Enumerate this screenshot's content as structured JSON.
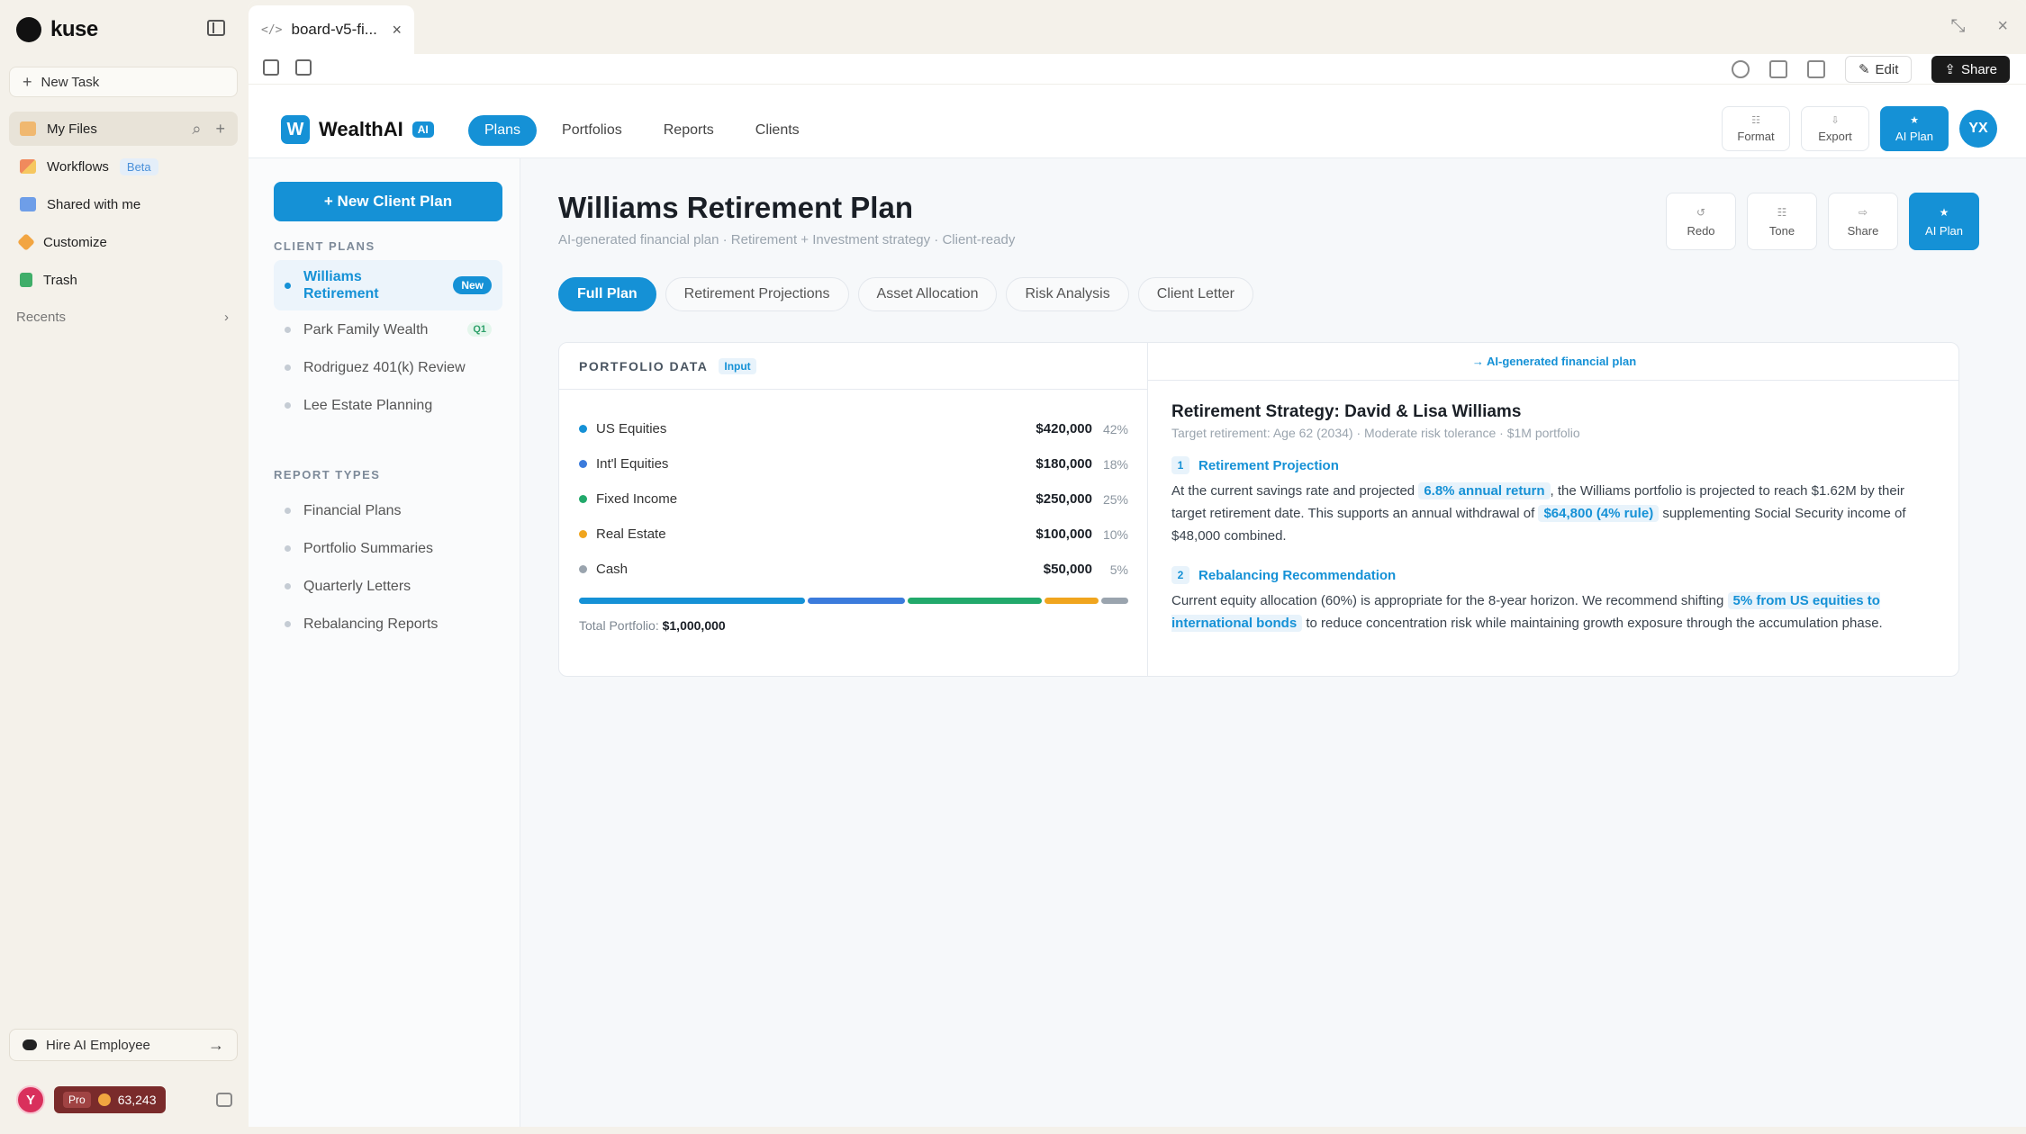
{
  "app": {
    "brand": "kuse",
    "new_task": "New Task",
    "nav": [
      {
        "label": "My Files",
        "icon": "folder-icon"
      },
      {
        "label": "Workflows",
        "icon": "workflow-icon",
        "badge": "Beta"
      },
      {
        "label": "Shared with me",
        "icon": "shared-icon"
      },
      {
        "label": "Customize",
        "icon": "customize-icon"
      },
      {
        "label": "Trash",
        "icon": "trash-icon"
      }
    ],
    "recents": "Recents",
    "hire": "Hire AI Employee",
    "user_initial": "Y",
    "plan_badge": "Pro",
    "credits": "63,243"
  },
  "window": {
    "tab_title": "board-v5-fi...",
    "edit_label": "Edit",
    "share_label": "Share"
  },
  "wealth": {
    "logo_letter": "W",
    "name": "WealthAI",
    "ai_badge": "AI",
    "nav": [
      "Plans",
      "Portfolios",
      "Reports",
      "Clients"
    ],
    "header_actions": [
      {
        "glyph": "☷",
        "label": "Format"
      },
      {
        "glyph": "⇩",
        "label": "Export"
      },
      {
        "glyph": "★",
        "label": "AI Plan"
      }
    ],
    "user_initials": "YX",
    "new_plan": "+ New Client Plan",
    "client_plans_label": "CLIENT PLANS",
    "client_plans": [
      {
        "label": "Williams Retirement",
        "badge": "New"
      },
      {
        "label": "Park Family Wealth",
        "badge": "Q1"
      },
      {
        "label": "Rodriguez 401(k) Review"
      },
      {
        "label": "Lee Estate Planning"
      }
    ],
    "report_types_label": "REPORT TYPES",
    "report_types": [
      "Financial Plans",
      "Portfolio Summaries",
      "Quarterly Letters",
      "Rebalancing Reports"
    ]
  },
  "page": {
    "title": "Williams Retirement Plan",
    "subtitle": "AI-generated financial plan · Retirement + Investment strategy · Client-ready",
    "actions": [
      {
        "glyph": "↺",
        "label": "Redo"
      },
      {
        "glyph": "☷",
        "label": "Tone"
      },
      {
        "glyph": "⇨",
        "label": "Share"
      },
      {
        "glyph": "★",
        "label": "AI Plan"
      }
    ],
    "tabs": [
      "Full Plan",
      "Retirement Projections",
      "Asset Allocation",
      "Risk Analysis",
      "Client Letter"
    ]
  },
  "portfolio": {
    "heading": "PORTFOLIO DATA",
    "input_tag": "Input",
    "holdings": [
      {
        "name": "US Equities",
        "value": "$420,000",
        "pct": "42%",
        "share": 42,
        "color": "#1591d6"
      },
      {
        "name": "Int'l Equities",
        "value": "$180,000",
        "pct": "18%",
        "share": 18,
        "color": "#3b7bdc"
      },
      {
        "name": "Fixed Income",
        "value": "$250,000",
        "pct": "25%",
        "share": 25,
        "color": "#22a96b"
      },
      {
        "name": "Real Estate",
        "value": "$100,000",
        "pct": "10%",
        "share": 10,
        "color": "#f0a51e"
      },
      {
        "name": "Cash",
        "value": "$50,000",
        "pct": "5%",
        "share": 5,
        "color": "#9aa4ae"
      }
    ],
    "total_label": "Total Portfolio:",
    "total_value": "$1,000,000"
  },
  "plan": {
    "header": "→  AI-generated financial plan",
    "title": "Retirement Strategy: David & Lisa Williams",
    "subtitle": "Target retirement: Age 62 (2034) · Moderate risk tolerance · $1M portfolio",
    "s1_num": "1",
    "s1_title": "Retirement Projection",
    "s1_a": "At the current savings rate and projected ",
    "s1_hl1": "6.8% annual return",
    "s1_b": ", the Williams portfolio is projected to reach $1.62M by their target retirement date. This supports an annual withdrawal of ",
    "s1_hl2": "$64,800 (4% rule)",
    "s1_c": " supplementing Social Security income of $48,000 combined.",
    "s2_num": "2",
    "s2_title": "Rebalancing Recommendation",
    "s2_a": "Current equity allocation (60%) is appropriate for the 8-year horizon. We recommend shifting ",
    "s2_hl": "5% from US equities to international bonds",
    "s2_b": " to reduce concentration risk while maintaining growth exposure through the accumulation phase."
  }
}
